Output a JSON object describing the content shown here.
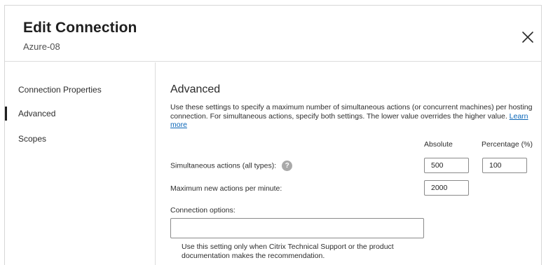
{
  "dialog": {
    "title": "Edit Connection",
    "subtitle": "Azure-08",
    "close_icon": "close-icon"
  },
  "sidebar": {
    "items": [
      {
        "label": "Connection Properties"
      },
      {
        "label": "Advanced",
        "active": true
      },
      {
        "label": "Scopes"
      }
    ]
  },
  "main": {
    "section_title": "Advanced",
    "description": "Use these settings to specify a maximum number of simultaneous actions (or concurrent machines) per hosting connection. For simultaneous actions, specify both settings. The lower value overrides the higher value.",
    "learn_more": "Learn more",
    "columns": {
      "absolute": "Absolute",
      "percentage": "Percentage (%)"
    },
    "simultaneous_actions": {
      "label": "Simultaneous actions (all types):",
      "help_icon": "question-mark-icon",
      "absolute_value": "500",
      "percentage_value": "100"
    },
    "max_new_actions": {
      "label": "Maximum new actions per minute:",
      "absolute_value": "2000"
    },
    "connection_options": {
      "label": "Connection options:",
      "value": "",
      "hint": "Use this setting only when Citrix Technical Support or the product documentation makes the recommendation."
    }
  },
  "colors": {
    "link": "#0a66b8",
    "help_icon_bg": "#a9a9a9",
    "border": "#dcdcdc"
  }
}
